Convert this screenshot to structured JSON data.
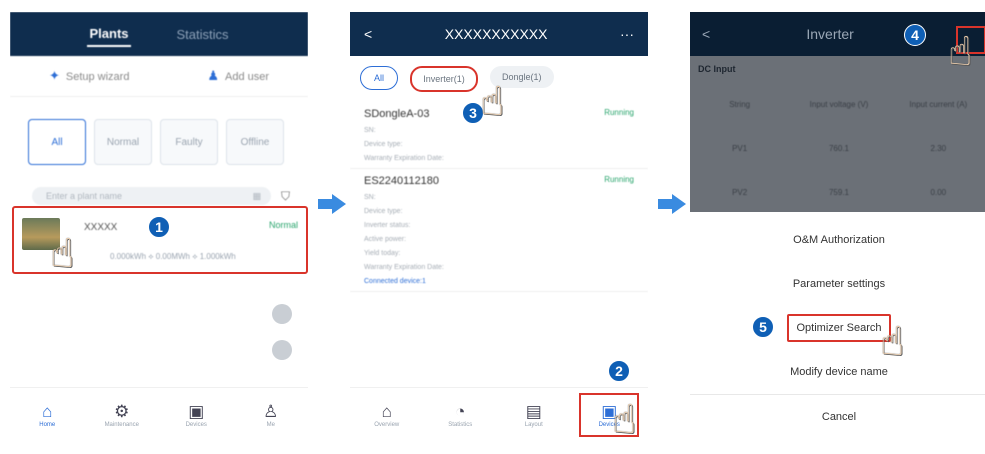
{
  "panel1": {
    "tabs": {
      "active": "Plants",
      "inactive": "Statistics"
    },
    "actions": {
      "setup": "Setup wizard",
      "add_user": "Add user"
    },
    "filters": [
      "All",
      "Normal",
      "Faulty",
      "Offline"
    ],
    "search_placeholder": "Enter a plant name",
    "plant": {
      "name": "XXXXX",
      "status": "Normal",
      "values": "0.000kWh  ⟡  0.00MWh  ⟡ 1.000kWh"
    },
    "nav": [
      "Home",
      "Maintenance",
      "Devices",
      "Me"
    ],
    "step": "1"
  },
  "panel2": {
    "title": "XXXXXXXXXXX",
    "chips": [
      "All",
      "Inverter(1)",
      "Dongle(1)"
    ],
    "devices": [
      {
        "name": "SDongleA-03",
        "status": "Running",
        "lines": [
          "SN:",
          "Device type:",
          "Warranty Expiration Date:"
        ]
      },
      {
        "name": "ES2240112180",
        "status": "Running",
        "lines": [
          "SN:",
          "Device type:",
          "Inverter status:",
          "Active power:",
          "Yield today:",
          "Warranty Expiration Date:"
        ],
        "link": "Connected device:1"
      }
    ],
    "nav": [
      "Overview",
      "Statistics",
      "Layout",
      "Devices"
    ],
    "steps": {
      "three": "3",
      "two": "2"
    }
  },
  "panel3": {
    "title": "Inverter",
    "section": "DC Input",
    "headers": [
      "String",
      "Input voltage (V)",
      "Input current (A)"
    ],
    "rows": [
      [
        "PV1",
        "760.1",
        "2.30"
      ],
      [
        "PV2",
        "759.1",
        "0.00"
      ]
    ],
    "menu": [
      "O&M Authorization",
      "Parameter settings",
      "Optimizer Search",
      "Modify device name",
      "Cancel"
    ],
    "steps": {
      "four": "4",
      "five": "5"
    }
  },
  "colors": {
    "header": "#0f2d4e",
    "accent": "#2d6ed6",
    "highlight": "#d9342b",
    "badge": "#0f5fb5",
    "running": "#2aa56d"
  },
  "icons": [
    "setup-wizard-icon",
    "add-user-icon",
    "map-icon",
    "filter-icon",
    "home-icon",
    "maintenance-icon",
    "devices-icon",
    "me-icon",
    "back-icon",
    "more-icon",
    "pointing-hand-icon",
    "arrow-right-icon"
  ]
}
